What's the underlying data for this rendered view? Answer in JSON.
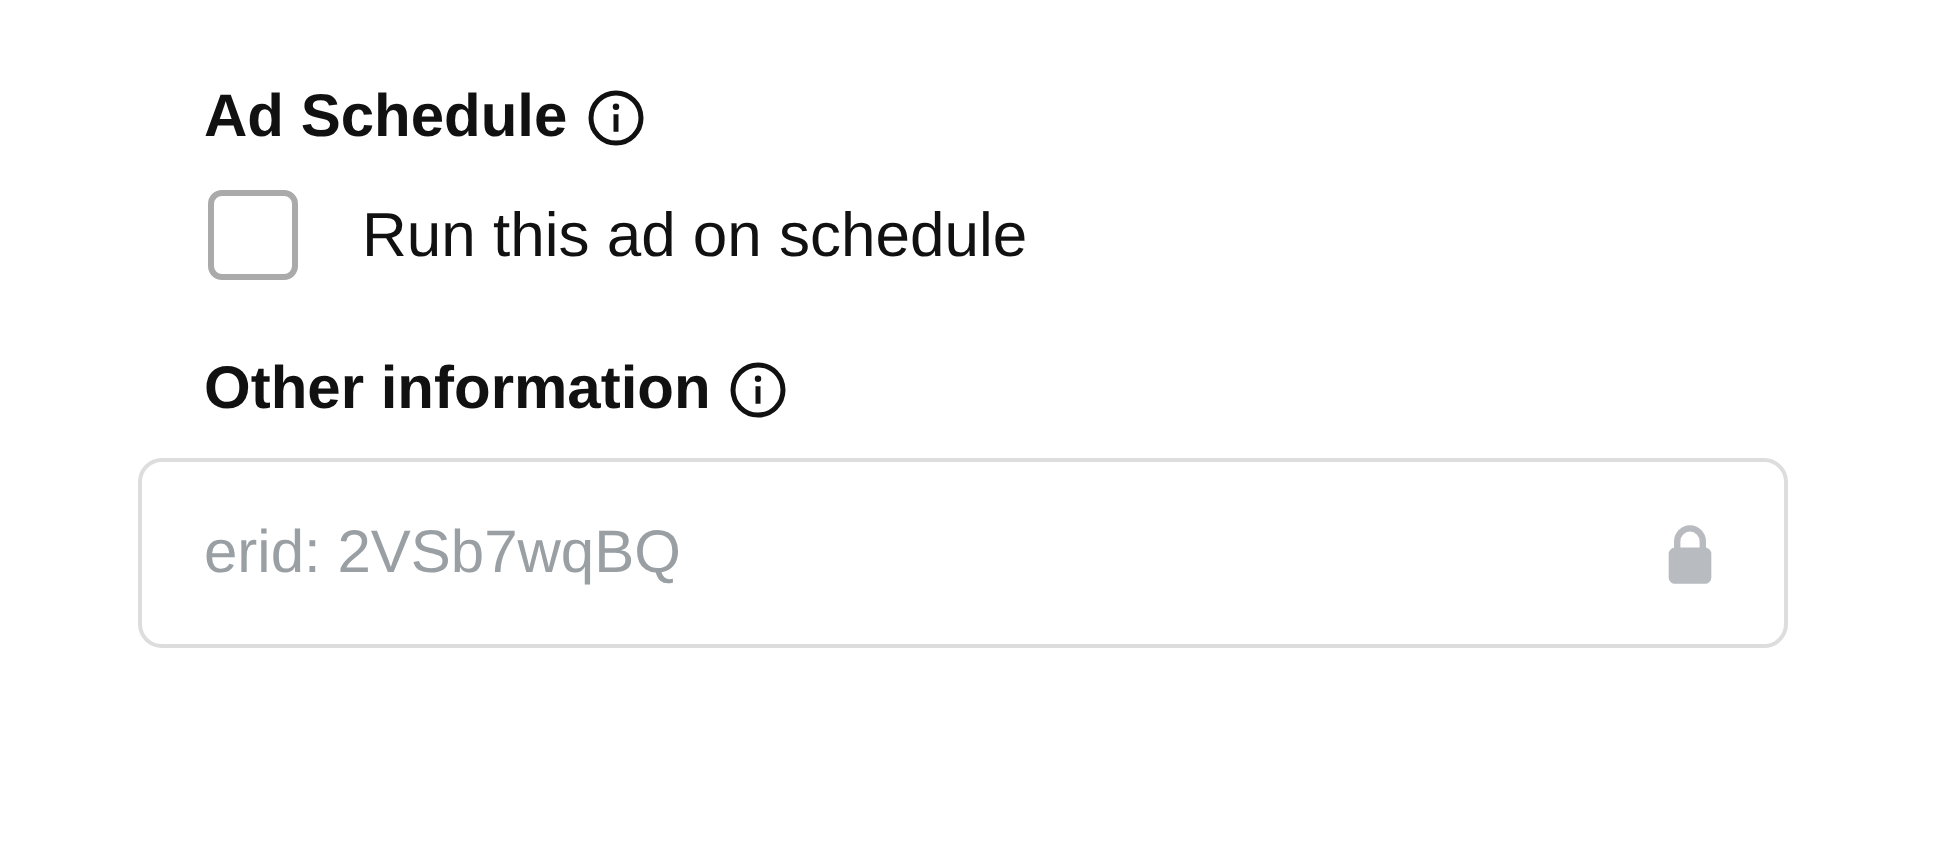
{
  "schedule": {
    "title": "Ad Schedule",
    "checkbox": {
      "label": "Run this ad on schedule",
      "checked": false
    }
  },
  "other": {
    "title": "Other information",
    "field": {
      "value": "erid: 2VSb7wqBQ",
      "locked": true
    }
  }
}
